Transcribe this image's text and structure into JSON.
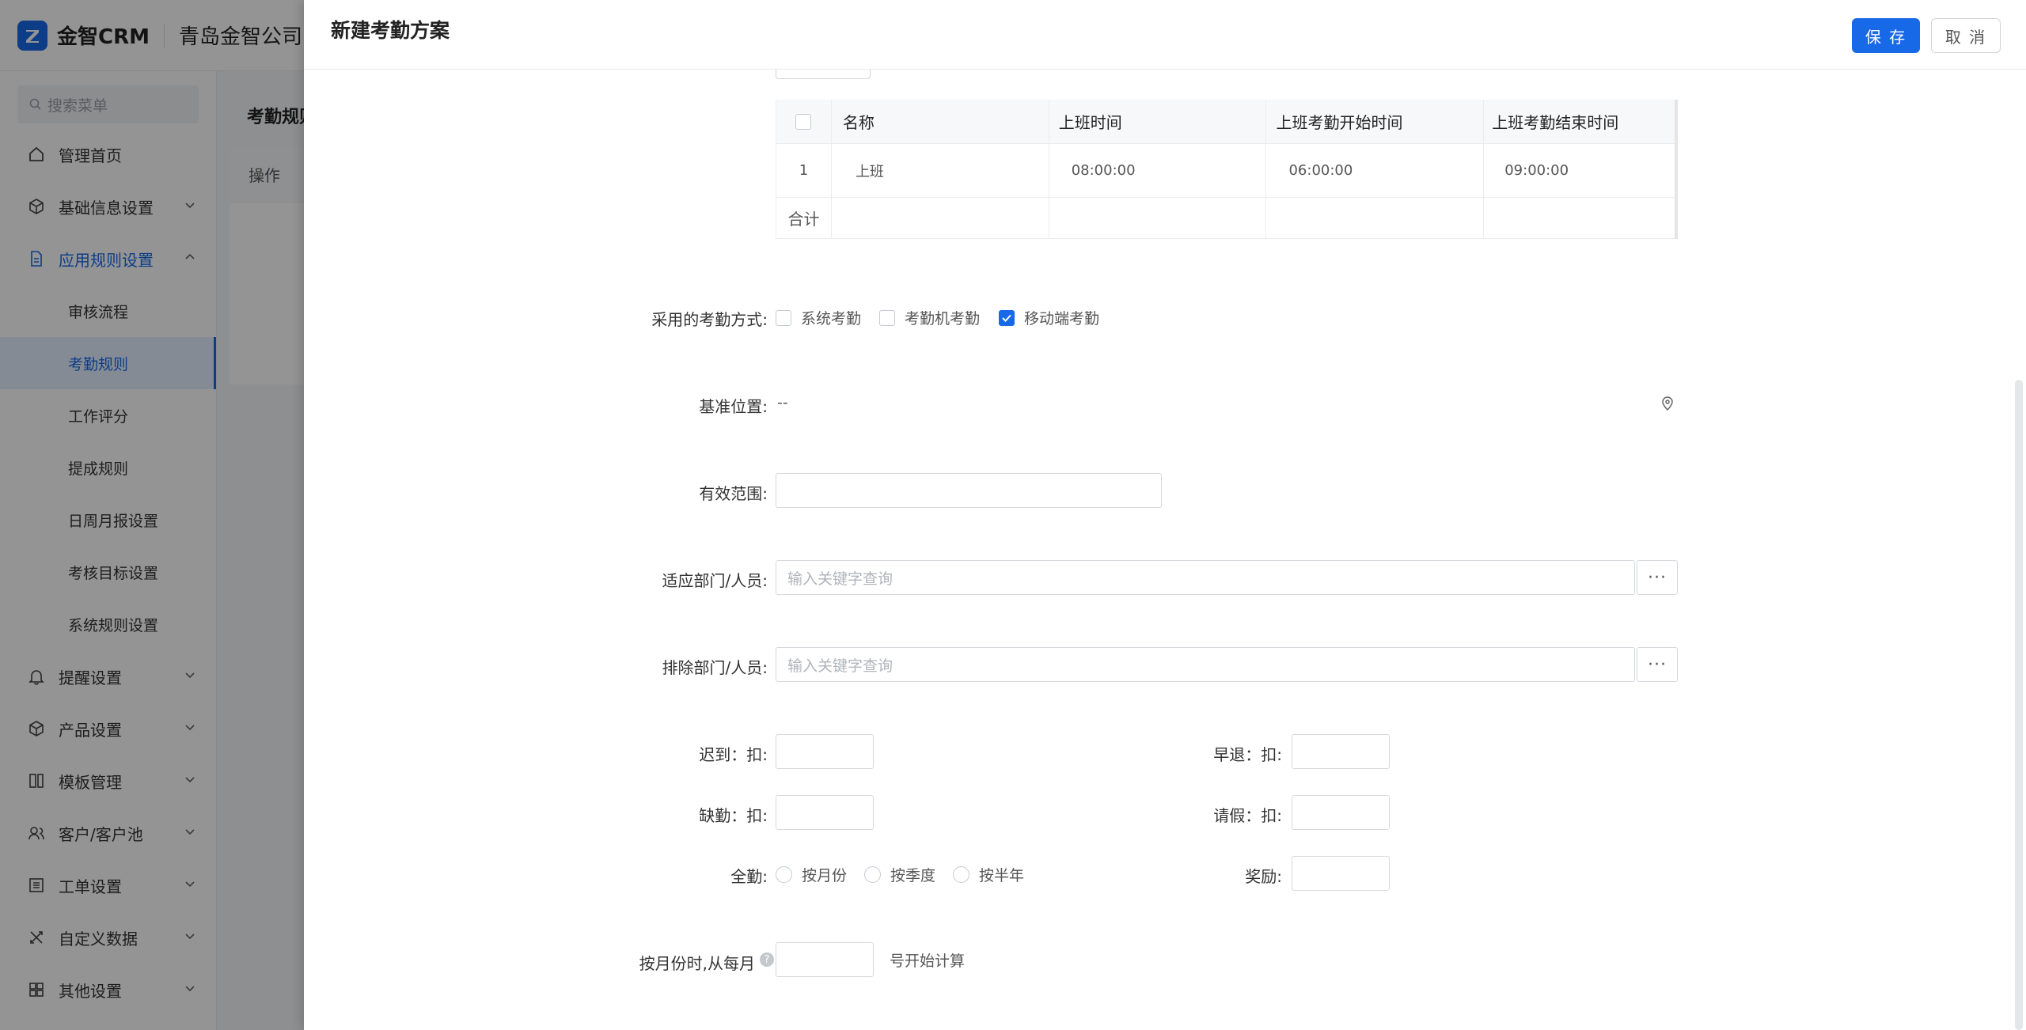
{
  "app": {
    "logo_text": "金智CRM",
    "company": "青岛金智公司"
  },
  "sidebar": {
    "search_placeholder": "搜索菜单",
    "items": [
      {
        "label": "管理首页"
      },
      {
        "label": "基础信息设置"
      },
      {
        "label": "应用规则设置"
      },
      {
        "label": "提醒设置"
      },
      {
        "label": "产品设置"
      },
      {
        "label": "模板管理"
      },
      {
        "label": "客户/客户池"
      },
      {
        "label": "工单设置"
      },
      {
        "label": "自定义数据"
      },
      {
        "label": "其他设置"
      }
    ],
    "sub_items": [
      {
        "label": "审核流程"
      },
      {
        "label": "考勤规则"
      },
      {
        "label": "工作评分"
      },
      {
        "label": "提成规则"
      },
      {
        "label": "日周月报设置"
      },
      {
        "label": "考核目标设置"
      },
      {
        "label": "系统规则设置"
      }
    ]
  },
  "content": {
    "title": "考勤规则",
    "column_header": "操作"
  },
  "drawer": {
    "title": "新建考勤方案",
    "save_label": "保 存",
    "cancel_label": "取 消",
    "table": {
      "headers": [
        "名称",
        "上班时间",
        "上班考勤开始时间",
        "上班考勤结束时间"
      ],
      "rows": [
        {
          "index": "1",
          "name": "上班",
          "start": "08:00:00",
          "check_start": "06:00:00",
          "check_end": "09:00:00"
        }
      ],
      "total_label": "合计"
    },
    "method": {
      "label": "采用的考勤方式:",
      "options": [
        {
          "label": "系统考勤",
          "checked": false
        },
        {
          "label": "考勤机考勤",
          "checked": false
        },
        {
          "label": "移动端考勤",
          "checked": true
        }
      ]
    },
    "location": {
      "label": "基准位置:",
      "value": "--"
    },
    "range": {
      "label": "有效范围:",
      "value": ""
    },
    "applicable": {
      "label": "适应部门/人员:",
      "placeholder": "输入关键字查询"
    },
    "excluded": {
      "label": "排除部门/人员:",
      "placeholder": "输入关键字查询"
    },
    "deductions": {
      "late_label": "迟到：扣:",
      "early_label": "早退：扣:",
      "absent_label": "缺勤：扣:",
      "leave_label": "请假：扣:"
    },
    "full_attendance": {
      "label": "全勤:",
      "options": [
        "按月份",
        "按季度",
        "按半年"
      ]
    },
    "reward": {
      "label": "奖励:"
    },
    "monthly": {
      "label": "按月份时,从每月",
      "suffix": "号开始计算"
    },
    "accent_color": "#1769e8"
  }
}
